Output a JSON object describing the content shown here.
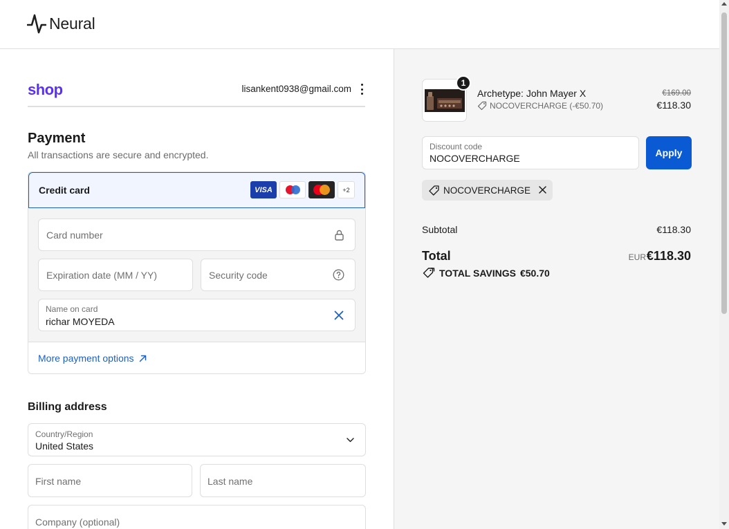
{
  "header": {
    "brand": "Neural"
  },
  "account": {
    "shop_logo": "shop",
    "email": "lisankent0938@gmail.com"
  },
  "payment": {
    "title": "Payment",
    "subtitle": "All transactions are secure and encrypted.",
    "method_label": "Credit card",
    "brands": [
      "VISA",
      "Maestro",
      "Mastercard"
    ],
    "brands_more": "+2",
    "card_number_placeholder": "Card number",
    "expiry_placeholder": "Expiration date (MM / YY)",
    "security_placeholder": "Security code",
    "name_label": "Name on card",
    "name_value": "richar MOYEDA",
    "more_options": "More payment options"
  },
  "billing": {
    "title": "Billing address",
    "country_label": "Country/Region",
    "country_value": "United States",
    "first_name_placeholder": "First name",
    "last_name_placeholder": "Last name",
    "company_placeholder": "Company (optional)"
  },
  "summary": {
    "item": {
      "quantity": "1",
      "name": "Archetype: John Mayer X",
      "discount": "NOCOVERCHARGE (-€50.70)",
      "original_price": "€169.00",
      "price": "€118.30"
    },
    "discount_label": "Discount code",
    "discount_value": "NOCOVERCHARGE",
    "apply_label": "Apply",
    "applied_code": "NOCOVERCHARGE",
    "subtotal_label": "Subtotal",
    "subtotal_value": "€118.30",
    "total_label": "Total",
    "total_currency": "EUR",
    "total_value": "€118.30",
    "savings_label": "TOTAL SAVINGS",
    "savings_value": "€50.70"
  },
  "colors": {
    "accent": "#1f5fbf",
    "apply_button": "#0a5bd3",
    "shop_purple": "#5a31f4",
    "visa_blue": "#1a3faa"
  }
}
